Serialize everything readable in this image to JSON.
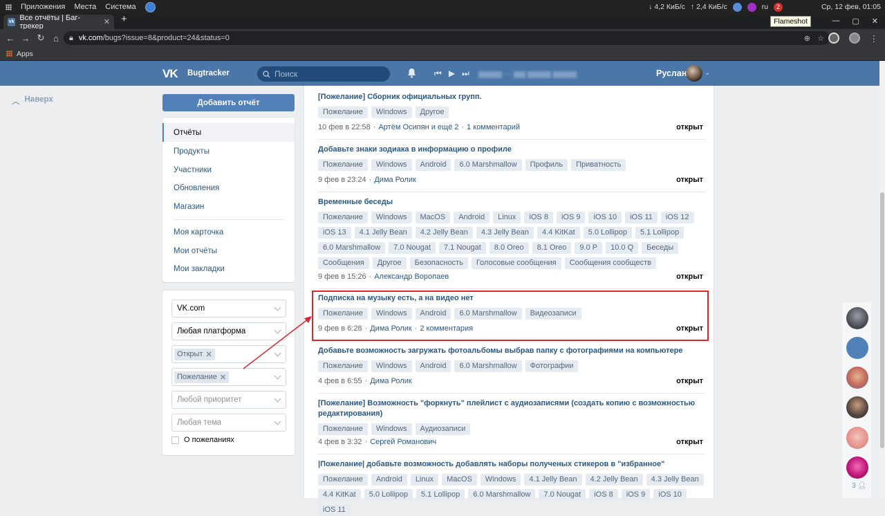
{
  "system": {
    "menu": [
      "Приложения",
      "Места",
      "Система"
    ],
    "net_down": "4,2 КиБ/с",
    "net_up": "2,4 КиБ/с",
    "lang": "ru",
    "badge": "2",
    "datetime": "Ср, 12 фев, 01:05"
  },
  "tooltip": "Flameshot",
  "browser": {
    "tab_title": "Все отчёты | Баг-трекер",
    "url_host": "vk.com",
    "url_path": "/bugs?issue=8&product=24&status=0",
    "bookmark_apps": "Apps"
  },
  "vk": {
    "logo": "VK",
    "title": "Bugtracker",
    "search_placeholder": "Поиск",
    "user_name": "Руслан"
  },
  "left": {
    "up_label": "Наверх",
    "add_button": "Добавить отчёт",
    "menu": [
      "Отчёты",
      "Продукты",
      "Участники",
      "Обновления",
      "Магазин"
    ],
    "menu2": [
      "Моя карточка",
      "Мои отчёты",
      "Мои закладки"
    ],
    "filters": {
      "site": "VK.com",
      "platform": "Любая платформа",
      "status_chip": "Открыт",
      "type_chip": "Пожелание",
      "priority_placeholder": "Любой приоритет",
      "topic_placeholder": "Любая тема",
      "checkbox_label": "О пожеланиях"
    }
  },
  "tickets": [
    {
      "title": "[Пожелание] Сборник официальных групп.",
      "tags": [
        "Пожелание",
        "Windows",
        "Другое"
      ],
      "date": "10 фев в 22:58",
      "author": "Артём Осипян и ещё 2",
      "comments": "1 комментарий",
      "status": "открыт"
    },
    {
      "title": "Добавьте знаки зодиака в информацию о профиле",
      "tags": [
        "Пожелание",
        "Windows",
        "Android",
        "6.0 Marshmallow",
        "Профиль",
        "Приватность"
      ],
      "date": "9 фев в 23:24",
      "author": "Дима Ролик",
      "comments": "",
      "status": "открыт"
    },
    {
      "title": "Временные беседы",
      "tags": [
        "Пожелание",
        "Windows",
        "MacOS",
        "Android",
        "Linux",
        "iOS 8",
        "iOS 9",
        "iOS 10",
        "iOS 11",
        "iOS 12",
        "iOS 13",
        "4.1 Jelly Bean",
        "4.2 Jelly Bean",
        "4.3 Jelly Bean",
        "4.4 KitKat",
        "5.0 Lollipop",
        "5.1 Lollipop",
        "6.0 Marshmallow",
        "7.0 Nougat",
        "7.1 Nougat",
        "8.0 Oreo",
        "8.1 Oreo",
        "9.0 P",
        "10.0 Q",
        "Беседы",
        "Сообщения",
        "Другое",
        "Безопасность",
        "Голосовые сообщения",
        "Сообщения сообществ"
      ],
      "date": "9 фев в 15:26",
      "author": "Александр Воропаев",
      "comments": "",
      "status": "открыт"
    },
    {
      "title": "Подписка на музыку есть, а на видео нет",
      "tags": [
        "Пожелание",
        "Windows",
        "Android",
        "6.0 Marshmallow",
        "Видеозаписи"
      ],
      "date": "9 фев в 6:28",
      "author": "Дима Ролик",
      "comments": "2 комментария",
      "status": "открыт"
    },
    {
      "title": "Добавьте возможность загружать фотоальбомы выбрав папку с фотографиями на компьютере",
      "tags": [
        "Пожелание",
        "Windows",
        "Android",
        "6.0 Marshmallow",
        "Фотографии"
      ],
      "date": "4 фев в 6:55",
      "author": "Дима Ролик",
      "comments": "",
      "status": "открыт"
    },
    {
      "title": "[Пожелание] Возможность \"форкнуть\" плейлист с аудиозаписями (создать копию с возможностью редактирования)",
      "tags": [
        "Пожелание",
        "Windows",
        "Аудиозаписи"
      ],
      "date": "4 фев в 3:32",
      "author": "Сергей Романович",
      "comments": "",
      "status": "открыт"
    },
    {
      "title": "|Пожелание| добавьте возможность добавлять наборы полученых стикеров в \"избранное\"",
      "tags": [
        "Пожелание",
        "Android",
        "Linux",
        "MacOS",
        "Windows",
        "4.1 Jelly Bean",
        "4.2 Jelly Bean",
        "4.3 Jelly Bean",
        "4.4 KitKat",
        "5.0 Lollipop",
        "5.1 Lollipop",
        "6.0 Marshmallow",
        "7.0 Nougat",
        "iOS 8",
        "iOS 9",
        "iOS 10",
        "iOS 11"
      ],
      "date": "",
      "author": "",
      "comments": "",
      "status": ""
    }
  ],
  "right_sidebar": {
    "online_count": "3"
  },
  "colors": {
    "vk_blue": "#4a76a8",
    "link": "#2a5885",
    "highlight_box": "#d9272e"
  }
}
